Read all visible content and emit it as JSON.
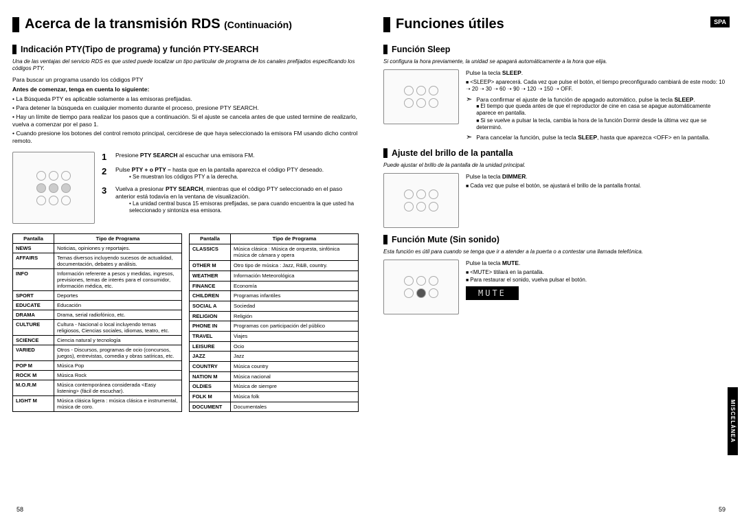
{
  "lang_badge": "SPA",
  "side_tab": "MISCELÁNEA",
  "page_left": "58",
  "page_right": "59",
  "left": {
    "h1_main": "Acerca de la transmisión RDS ",
    "h1_cont": "(Continuación)",
    "h2": "Indicación PTY(Tipo de programa) y función PTY-SEARCH",
    "intro": "Una de las ventajas del servicio RDS es que usted puede localizar un tipo particular de programa de los canales prefijados especificando los códigos PTY.",
    "para1": "Para buscar un programa usando los códigos PTY",
    "subhead": "Antes de comenzar, tenga en cuenta lo siguiente:",
    "bullets": [
      "La Búsqueda PTY es aplicable solamente a las emisoras prefijadas.",
      "Para detener la búsqueda en cualquier momento durante el proceso, presione PTY SEARCH.",
      "Hay un límite de tiempo para realizar los pasos que a continuación. Si el ajuste se cancela antes de que usted termine de realizarlo, vuelva a comenzar por el paso 1.",
      "Cuando presione los botones del control remoto principal, cerciórese de que haya seleccionado la emisora FM usando dicho control remoto."
    ],
    "steps": [
      {
        "num": "1",
        "txt_a": "Presione ",
        "bold": "PTY SEARCH",
        "txt_b": " al escuchar una emisora FM."
      },
      {
        "num": "2",
        "txt_a": "Pulse ",
        "bold": "PTY + o PTY –",
        "txt_b": " hasta que en la pantalla aparezca el código PTY deseado.",
        "sub": "Se muestran los códigos PTY a la derecha."
      },
      {
        "num": "3",
        "txt_a": "Vuelva a presionar ",
        "bold": "PTY SEARCH",
        "txt_b": ", mientras que el código PTY seleccionado en el paso anterior está todavía en la ventana de visualización.",
        "sub": "La unidad central busca 15 emisoras prefijadas, se para cuando encuentra la que usted ha seleccionado y sintoniza esa emisora."
      }
    ],
    "th_pantalla": "Pantalla",
    "th_tipo": "Tipo de Programa",
    "table_a": [
      [
        "NEWS",
        "Noticias, opiniones y reportajes."
      ],
      [
        "AFFAIRS",
        "Temas diversos incluyendo sucesos de actualidad, documentación, debates y análisis."
      ],
      [
        "INFO",
        "Información referente a pesos y medidas, ingresos, previsiones, temas de interés para el consumidor, información médica, etc."
      ],
      [
        "SPORT",
        "Deportes"
      ],
      [
        "EDUCATE",
        "Educación"
      ],
      [
        "DRAMA",
        "Drama, serial radiofónico, etc."
      ],
      [
        "CULTURE",
        "Cultura - Nacional o local incluyendo temas religiosos, Ciencias sociales, idiomas, teatro, etc."
      ],
      [
        "SCIENCE",
        "Ciencia natural y tecnología"
      ],
      [
        "VARIED",
        "Otros - Discursos, programas de ocio (concursos, juegos), entrevistas, comedia y obras satíricas, etc."
      ],
      [
        "POP M",
        "Música Pop"
      ],
      [
        "ROCK M",
        "Música Rock"
      ],
      [
        "M.O.R.M",
        "Música contemporánea considerada <Easy listening> (fácil de escuchar)."
      ],
      [
        "LIGHT M",
        "Música clásica ligera : música clásica e instrumental, música de coro."
      ]
    ],
    "table_b": [
      [
        "CLASSICS",
        "Música clásica : Música de orquesta, sinfónica música de cámara y opera"
      ],
      [
        "OTHER M",
        "Otro tipo de música : Jazz, R&B, country."
      ],
      [
        "WEATHER",
        "Información Meteorológica"
      ],
      [
        "FINANCE",
        "Economía"
      ],
      [
        "CHILDREN",
        "Programas infantiles"
      ],
      [
        "SOCIAL A",
        "Sociedad"
      ],
      [
        "RELIGION",
        "Religión"
      ],
      [
        "PHONE IN",
        "Programas con participación del público"
      ],
      [
        "TRAVEL",
        "Viajes"
      ],
      [
        "LEISURE",
        "Ocio"
      ],
      [
        "JAZZ",
        "Jazz"
      ],
      [
        "COUNTRY",
        "Música country"
      ],
      [
        "NATION M",
        "Música nacional"
      ],
      [
        "OLDIES",
        "Música de siempre"
      ],
      [
        "FOLK M",
        "Música folk"
      ],
      [
        "DOCUMENT",
        "Documentales"
      ]
    ]
  },
  "right": {
    "h1": "Funciones útiles",
    "sleep": {
      "h2": "Función Sleep",
      "intro": "Si configura la hora previamente, la unidad se apagará automáticamente a la hora que elija.",
      "line1_a": "Pulse la tecla ",
      "line1_b": "SLEEP",
      "line1_c": ".",
      "sq1": "<SLEEP> aparecerá. Cada vez que pulse el botón, el tiempo preconfigurado cambiará de este modo: 10 ➝ 20 ➝ 30 ➝ 60 ➝ 90 ➝ 120 ➝ 150 ➝ OFF.",
      "arrow1_a": "Para confirmar el ajuste de la función de apagado automático, pulse la tecla ",
      "arrow1_b": "SLEEP",
      "arrow1_c": ".",
      "sq2": "El tiempo que queda antes de que el reproductor de cine en casa se apague automáticamente aparece en pantalla.",
      "sq3": "Si se vuelve a pulsar la tecla, cambia la hora de la función Dormir desde la última vez que se determinó.",
      "arrow2_a": "Para cancelar la función, pulse la tecla ",
      "arrow2_b": "SLEEP",
      "arrow2_c": ", hasta que aparezca <OFF> en la pantalla."
    },
    "bright": {
      "h2": "Ajuste del brillo de la pantalla",
      "intro": "Puede ajustar el brillo de la pantalla de la unidad principal.",
      "line1_a": "Pulse la tecla ",
      "line1_b": "DIMMER",
      "line1_c": ".",
      "sq1": "Cada vez que pulse el botón, se ajustará el brillo de la pantalla frontal."
    },
    "mute": {
      "h2": "Función Mute (Sin sonido)",
      "intro": "Esta función es útil para cuando se tenga que ir a atender a la puerta o a contestar una llamada telefónica.",
      "line1_a": "Pulse la tecla ",
      "line1_b": "MUTE",
      "line1_c": ".",
      "sq1": "<MUTE> titilará en la pantalla.",
      "sq2": "Para restaurar el sonido, vuelva pulsar el botón.",
      "display": "MUTE"
    }
  }
}
